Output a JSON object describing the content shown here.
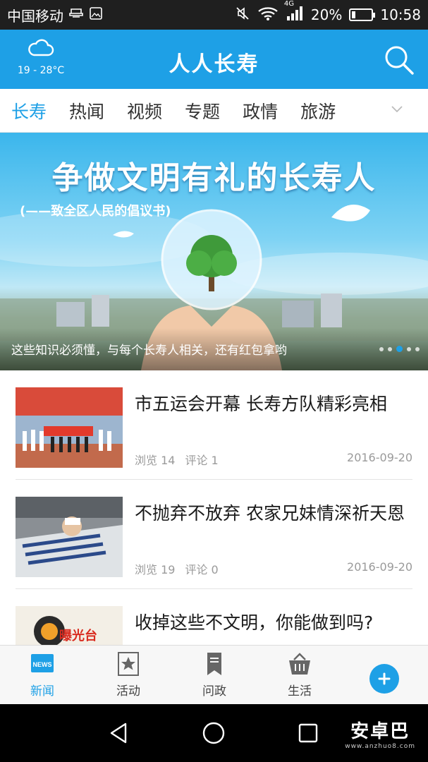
{
  "status_bar": {
    "carrier": "中国移动",
    "network_badge": "4G",
    "battery_percent": "20%",
    "battery_level": 0.2,
    "time": "10:58",
    "icons": [
      "usb-icon",
      "screenshot-icon",
      "mute-icon",
      "wifi-icon",
      "signal-icon",
      "battery-icon"
    ]
  },
  "app_bar": {
    "title": "人人长寿",
    "weather_icon": "cloud-icon",
    "temperature": "19 - 28°C",
    "search_icon": "search-icon"
  },
  "tabs": [
    {
      "label": "长寿",
      "active": true
    },
    {
      "label": "热闻",
      "active": false
    },
    {
      "label": "视频",
      "active": false
    },
    {
      "label": "专题",
      "active": false
    },
    {
      "label": "政情",
      "active": false
    },
    {
      "label": "旅游",
      "active": false
    }
  ],
  "banner": {
    "headline": "争做文明有礼的长寿人",
    "subheadline": "(——致全区人民的倡议书)",
    "caption": "这些知识必须懂，与每个长寿人相关，还有红包拿哟",
    "slide_count": 5,
    "active_slide": 3
  },
  "news": [
    {
      "title": "市五运会开幕  长寿方队精彩亮相",
      "views": "浏览 14",
      "comments": "评论 1",
      "date": "2016-09-20"
    },
    {
      "title": "不抛弃不放弃  农家兄妹情深祈天恩",
      "views": "浏览 19",
      "comments": "评论 0",
      "date": "2016-09-20"
    },
    {
      "title": "收掉这些不文明，你能做到吗?",
      "thumb_label": "曝光台"
    }
  ],
  "bottom_nav": [
    {
      "label": "新闻",
      "icon": "news-icon",
      "active": true
    },
    {
      "label": "活动",
      "icon": "star-icon",
      "active": false
    },
    {
      "label": "问政",
      "icon": "bookmark-icon",
      "active": false
    },
    {
      "label": "生活",
      "icon": "basket-icon",
      "active": false
    }
  ],
  "news_icon_text": "NEWS",
  "fab_icon": "plus-icon",
  "watermark": {
    "main": "安卓巴",
    "sub": "www.anzhuo8.com"
  },
  "colors": {
    "accent": "#1ea0e6",
    "status_bar": "#1f1f1f",
    "text": "#1a1a1a",
    "muted": "#9a9a9a"
  }
}
